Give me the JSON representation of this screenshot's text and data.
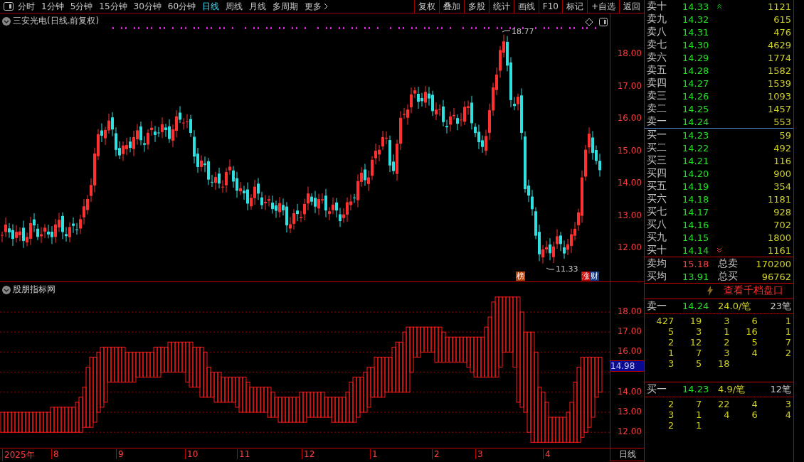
{
  "toolbar": {
    "periods": [
      {
        "label": "分时",
        "selected": false
      },
      {
        "label": "1分钟",
        "selected": false
      },
      {
        "label": "5分钟",
        "selected": false
      },
      {
        "label": "15分钟",
        "selected": false
      },
      {
        "label": "30分钟",
        "selected": false
      },
      {
        "label": "60分钟",
        "selected": false
      },
      {
        "label": "日线",
        "selected": true
      },
      {
        "label": "周线",
        "selected": false
      },
      {
        "label": "月线",
        "selected": false
      },
      {
        "label": "多周期",
        "selected": false
      }
    ],
    "more": "更多",
    "buttons": [
      "复权",
      "叠加",
      "多股",
      "统计",
      "画线",
      "F10",
      "标记",
      "+自选",
      "返回"
    ]
  },
  "chart": {
    "title": "三安光电(日线.前复权)",
    "y_ticks": [
      "18.00",
      "17.00",
      "16.00",
      "15.00",
      "14.00",
      "13.00",
      "12.00"
    ],
    "high_label": "18.77",
    "low_label": "11.33",
    "badges": [
      {
        "text": "榜",
        "color": "#c04000"
      },
      {
        "text": "涨",
        "color": "#c00000"
      },
      {
        "text": "财",
        "color": "#103c90"
      }
    ]
  },
  "indicator": {
    "title": "股朋指标网",
    "y_ticks": [
      "18.00",
      "17.00",
      "16.00",
      "14.00",
      "13.00",
      "12.00"
    ],
    "current_value": "14.98"
  },
  "x_axis": {
    "labels": [
      "2025年",
      "8",
      "9",
      "10",
      "11",
      "12",
      "1",
      "2",
      "3",
      "4"
    ],
    "period": "日线"
  },
  "order_book": {
    "asks": [
      {
        "label": "卖十",
        "price": "14.33",
        "volume": "1121"
      },
      {
        "label": "卖九",
        "price": "14.32",
        "volume": "615"
      },
      {
        "label": "卖八",
        "price": "14.31",
        "volume": "476"
      },
      {
        "label": "卖七",
        "price": "14.30",
        "volume": "4629"
      },
      {
        "label": "卖六",
        "price": "14.29",
        "volume": "1774"
      },
      {
        "label": "卖五",
        "price": "14.28",
        "volume": "1582"
      },
      {
        "label": "卖四",
        "price": "14.27",
        "volume": "1539"
      },
      {
        "label": "卖三",
        "price": "14.26",
        "volume": "1093"
      },
      {
        "label": "卖二",
        "price": "14.25",
        "volume": "1457"
      },
      {
        "label": "卖一",
        "price": "14.24",
        "volume": "553"
      }
    ],
    "bids": [
      {
        "label": "买一",
        "price": "14.23",
        "volume": "59"
      },
      {
        "label": "买二",
        "price": "14.22",
        "volume": "492"
      },
      {
        "label": "买三",
        "price": "14.21",
        "volume": "116"
      },
      {
        "label": "买四",
        "price": "14.20",
        "volume": "900"
      },
      {
        "label": "买五",
        "price": "14.19",
        "volume": "354"
      },
      {
        "label": "买六",
        "price": "14.18",
        "volume": "1181"
      },
      {
        "label": "买七",
        "price": "14.17",
        "volume": "928"
      },
      {
        "label": "买八",
        "price": "14.16",
        "volume": "702"
      },
      {
        "label": "买九",
        "price": "14.15",
        "volume": "1800"
      },
      {
        "label": "买十",
        "price": "14.14",
        "volume": "1161"
      }
    ],
    "summary": [
      {
        "label": "卖均",
        "price": "15.18",
        "color": "#ff3c3c",
        "total_label": "总卖",
        "total": "170200"
      },
      {
        "label": "买均",
        "price": "13.91",
        "color": "#20e020",
        "total_label": "总买",
        "total": "96762"
      }
    ],
    "link": "查看千档盘口"
  },
  "ticks": [
    {
      "label": "卖一",
      "price": "14.24",
      "average": "24.0/笔",
      "count": "23笔",
      "rows": [
        [
          "427",
          "19",
          "3",
          "6",
          "1"
        ],
        [
          "5",
          "3",
          "1",
          "16",
          "1"
        ],
        [
          "2",
          "12",
          "2",
          "5",
          "7"
        ],
        [
          "1",
          "7",
          "3",
          "4",
          "2"
        ],
        [
          "3",
          "5",
          "18"
        ]
      ]
    },
    {
      "label": "买一",
      "price": "14.23",
      "average": "4.9/笔",
      "count": "12笔",
      "rows": [
        [
          "2",
          "7",
          "22",
          "4",
          "3"
        ],
        [
          "3",
          "1",
          "4",
          "6",
          "4"
        ],
        [
          "2",
          "1"
        ]
      ]
    }
  ]
}
